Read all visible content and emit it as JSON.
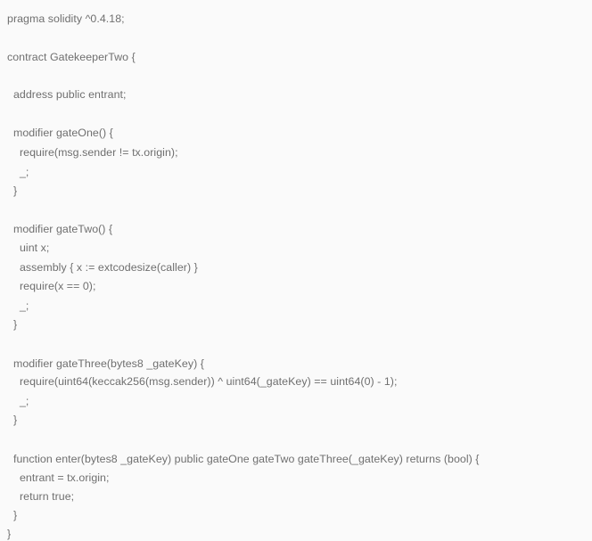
{
  "code": {
    "language": "solidity",
    "lines": [
      "pragma solidity ^0.4.18;",
      "",
      "contract GatekeeperTwo {",
      "",
      "  address public entrant;",
      "",
      "  modifier gateOne() {",
      "    require(msg.sender != tx.origin);",
      "    _;",
      "  }",
      "",
      "  modifier gateTwo() {",
      "    uint x;",
      "    assembly { x := extcodesize(caller) }",
      "    require(x == 0);",
      "    _;",
      "  }",
      "",
      "  modifier gateThree(bytes8 _gateKey) {",
      "    require(uint64(keccak256(msg.sender)) ^ uint64(_gateKey) == uint64(0) - 1);",
      "    _;",
      "  }",
      "",
      "  function enter(bytes8 _gateKey) public gateOne gateTwo gateThree(_gateKey) returns (bool) {",
      "    entrant = tx.origin;",
      "    return true;",
      "  }",
      "}"
    ]
  }
}
